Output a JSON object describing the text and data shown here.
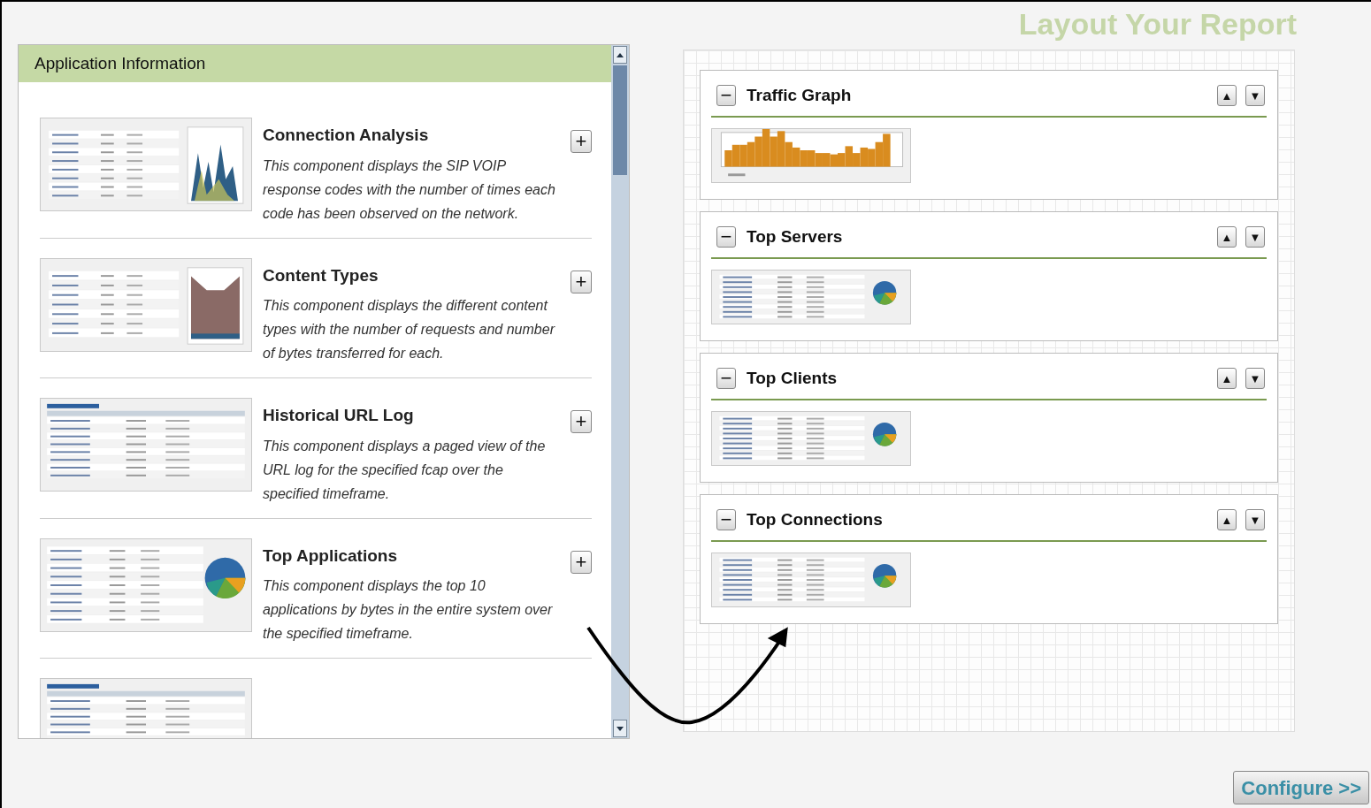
{
  "library": {
    "title": "Application Information",
    "items": [
      {
        "title": "Connection Analysis",
        "description": "This component displays the SIP VOIP response codes with the number of times each code has been observed on the network.",
        "thumbnail": {
          "kind": "table-area"
        },
        "add": "+"
      },
      {
        "title": "Content Types",
        "description": "This component displays the different content types with the number of requests and number of bytes transferred for each.",
        "thumbnail": {
          "kind": "table-stacked"
        },
        "add": "+"
      },
      {
        "title": "Historical URL Log",
        "description": "This component displays a paged view of the URL log for the specified fcap over the specified timeframe.",
        "thumbnail": {
          "kind": "table"
        },
        "add": "+"
      },
      {
        "title": "Top Applications",
        "description": "This component displays the top 10 applications by bytes in the entire system over the specified timeframe.",
        "thumbnail": {
          "kind": "table-pie"
        },
        "add": "+"
      }
    ],
    "partial_item": {
      "thumbnail": {
        "kind": "table"
      }
    }
  },
  "report": {
    "title": "Layout Your Report",
    "sections": [
      {
        "title": "Traffic Graph",
        "thumbnail": {
          "kind": "bars"
        },
        "collapse": "−",
        "up": "▲",
        "down": "▼"
      },
      {
        "title": "Top Servers",
        "thumbnail": {
          "kind": "table-pie"
        },
        "collapse": "−",
        "up": "▲",
        "down": "▼"
      },
      {
        "title": "Top Clients",
        "thumbnail": {
          "kind": "table-pie"
        },
        "collapse": "−",
        "up": "▲",
        "down": "▼"
      },
      {
        "title": "Top Connections",
        "thumbnail": {
          "kind": "table-pie"
        },
        "collapse": "−",
        "up": "▲",
        "down": "▼"
      }
    ]
  },
  "configure_button": "Configure >>"
}
